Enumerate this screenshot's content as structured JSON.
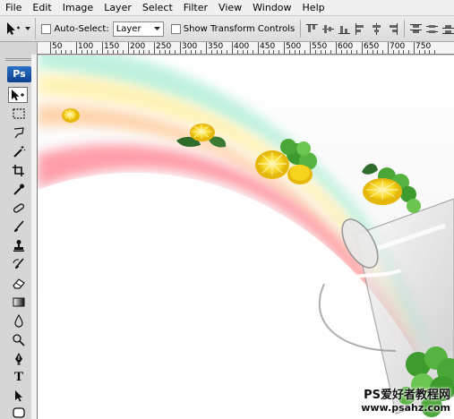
{
  "menu": {
    "items": [
      "File",
      "Edit",
      "Image",
      "Layer",
      "Select",
      "Filter",
      "View",
      "Window",
      "Help"
    ]
  },
  "options_bar": {
    "tool_icon": "move-tool-icon",
    "auto_select_label": "Auto-Select:",
    "auto_select_checked": false,
    "auto_select_target": "Layer",
    "transform_controls_label": "Show Transform Controls",
    "transform_controls_checked": false
  },
  "toolbox": {
    "logo": "Ps",
    "tools": [
      "move",
      "marquee",
      "lasso",
      "magic-wand",
      "crop",
      "eyedropper",
      "healing-brush",
      "brush",
      "clone-stamp",
      "history-brush",
      "eraser",
      "gradient",
      "blur",
      "dodge",
      "pen",
      "type",
      "path-selection",
      "shape"
    ],
    "type_tool_glyph": "T",
    "active_tool": "move"
  },
  "ruler": {
    "top_labels": [
      "50",
      "100",
      "150",
      "200",
      "250",
      "300",
      "350",
      "400",
      "450",
      "500",
      "550",
      "600",
      "650",
      "700",
      "750"
    ]
  },
  "canvas": {
    "colors": {
      "rainbow_pink": "#ff9aa5",
      "rainbow_peach": "#ffd2a8",
      "rainbow_yellow": "#fff2b3",
      "rainbow_green": "#c8f5c0",
      "rainbow_mint": "#b9f0dc",
      "lemon": "#f6d31d",
      "leaf": "#3e9b2e"
    }
  },
  "watermark": {
    "line1": "PS爱好者教程网",
    "line2": "www.psahz.com"
  }
}
